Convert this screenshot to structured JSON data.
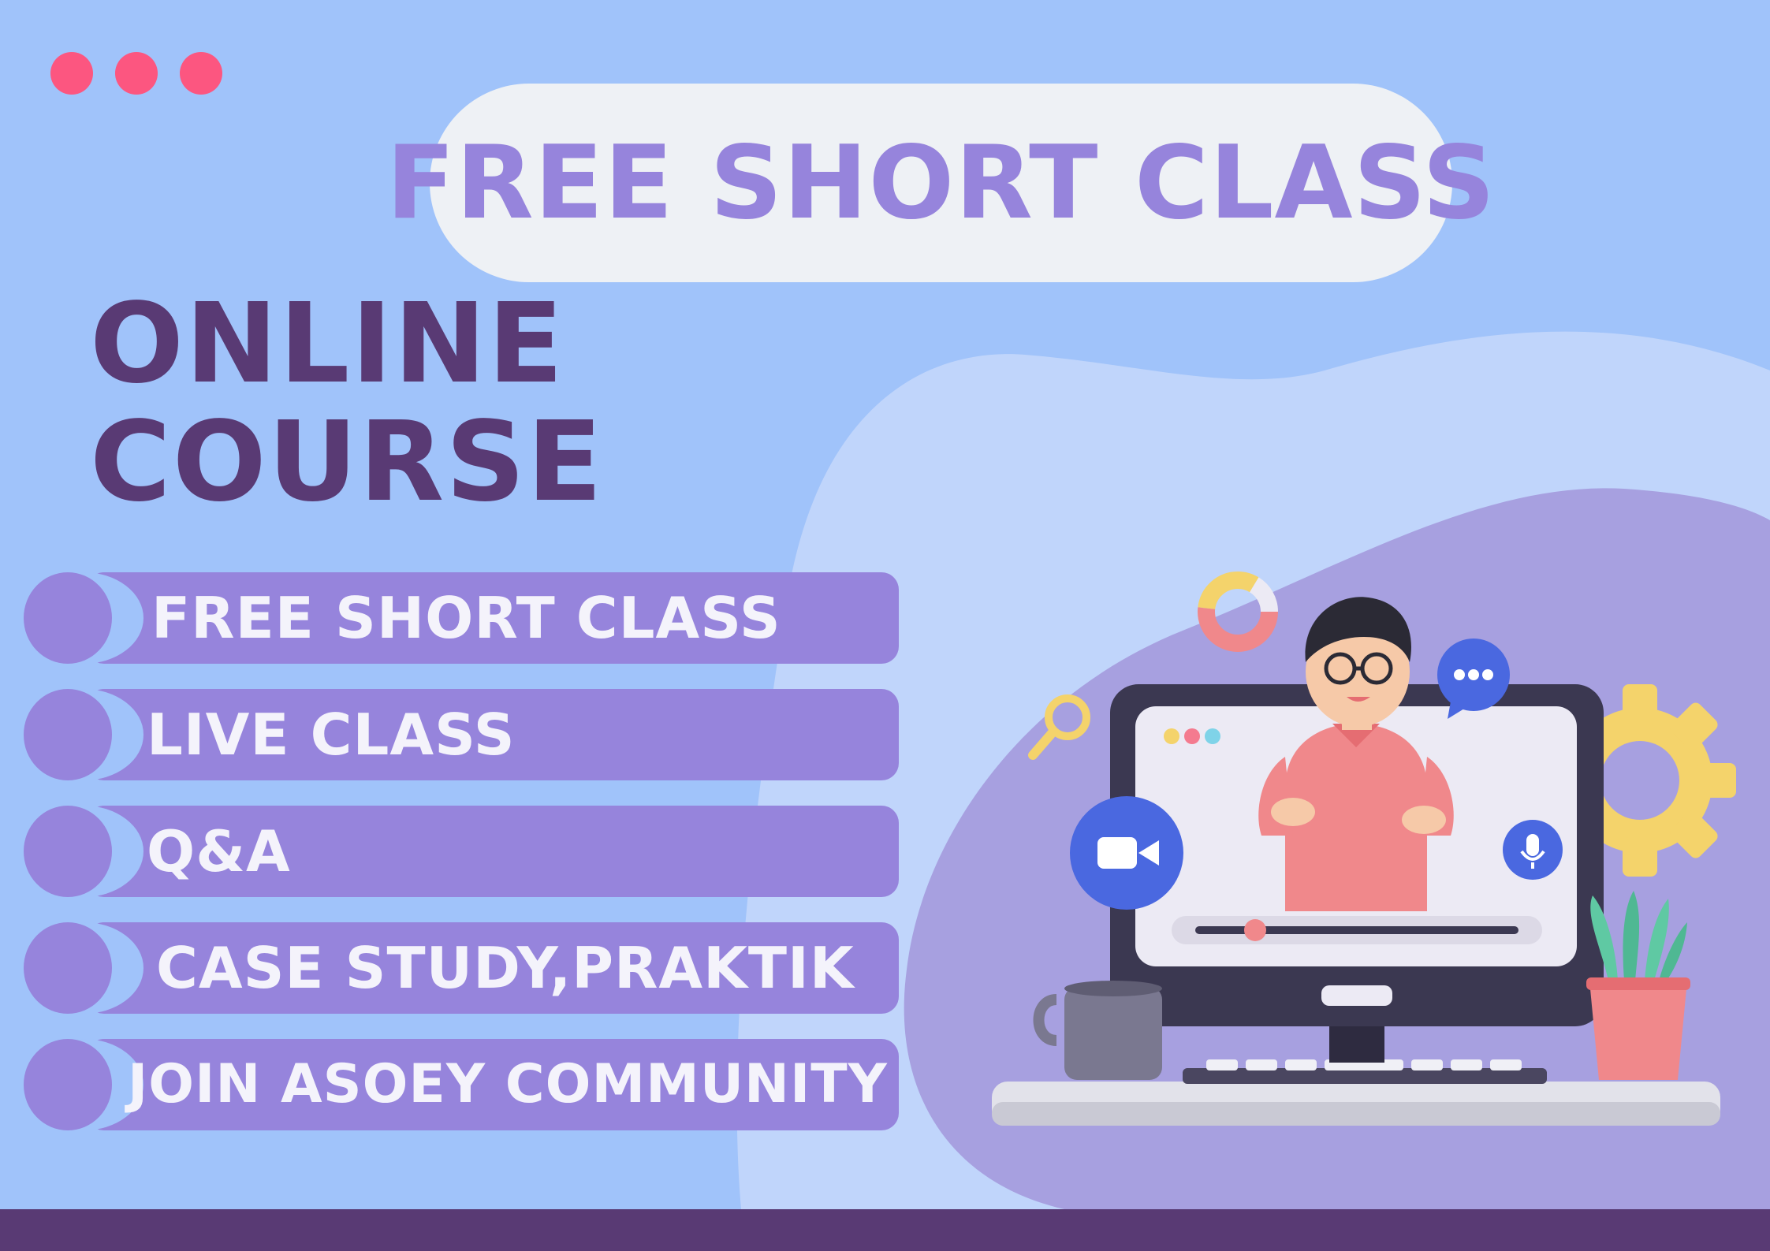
{
  "banner": {
    "title": "FREE SHORT CLASS"
  },
  "heading": {
    "line1": "ONLINE",
    "line2": "COURSE"
  },
  "features": [
    {
      "label": "FREE SHORT CLASS"
    },
    {
      "label": "LIVE CLASS"
    },
    {
      "label": "Q&A"
    },
    {
      "label": "CASE STUDY,PRAKTIK"
    },
    {
      "label": "JOIN ASOEY COMMUNITY"
    }
  ],
  "icons": {
    "window_dots": "traffic-dots",
    "camera": "video-camera-icon",
    "mic": "microphone-icon",
    "chat": "chat-bubble-icon",
    "search": "magnifier-icon",
    "settings": "gear-icon",
    "chart": "donut-chart-icon"
  },
  "colors": {
    "background": "#a0c3fa",
    "accent_purple": "#9684dc",
    "dark_purple": "#593a74",
    "pink": "#fc5680",
    "light_blob": "#c0d5fb",
    "lavender_blob": "#a7a0e0"
  }
}
